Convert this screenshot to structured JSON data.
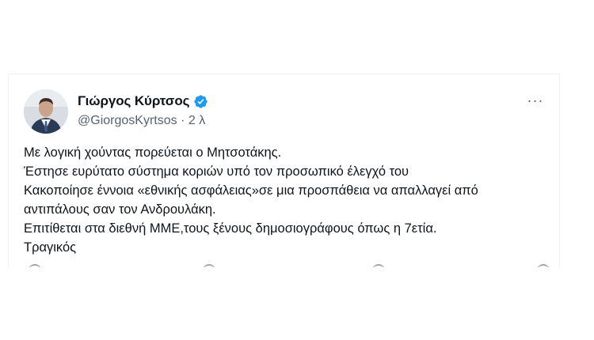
{
  "tweet": {
    "author_name": "Γιώργος Κύρτσος",
    "handle": "@GiorgosKyrtsos",
    "separator": "·",
    "time": "2 λ",
    "more_icon": "more-horizontal-icon",
    "more_glyph": "···",
    "verified_icon": "verified-badge-icon",
    "verified_color": "#1d9bf0",
    "text_lines": [
      "Με λογική χούντας πορεύεται ο Μητσοτάκης.",
      "Έστησε ευρύτατο σύστημα κοριών υπό τον προσωπικό έλεγχό του",
      "Κακοποίησε έννοια «εθνικής ασφάλειας»σε μια προσπάθεια να απαλλαγεί από",
      "αντιπάλους σαν τον Ανδρουλάκη.",
      "Επιτίθεται στα διεθνή ΜΜΕ,τους ξένους δημοσιογράφους όπως η 7ετία.",
      "Τραγικός"
    ]
  },
  "colors": {
    "text_primary": "#0f1419",
    "text_secondary": "#536471",
    "border": "#eff3f4"
  }
}
